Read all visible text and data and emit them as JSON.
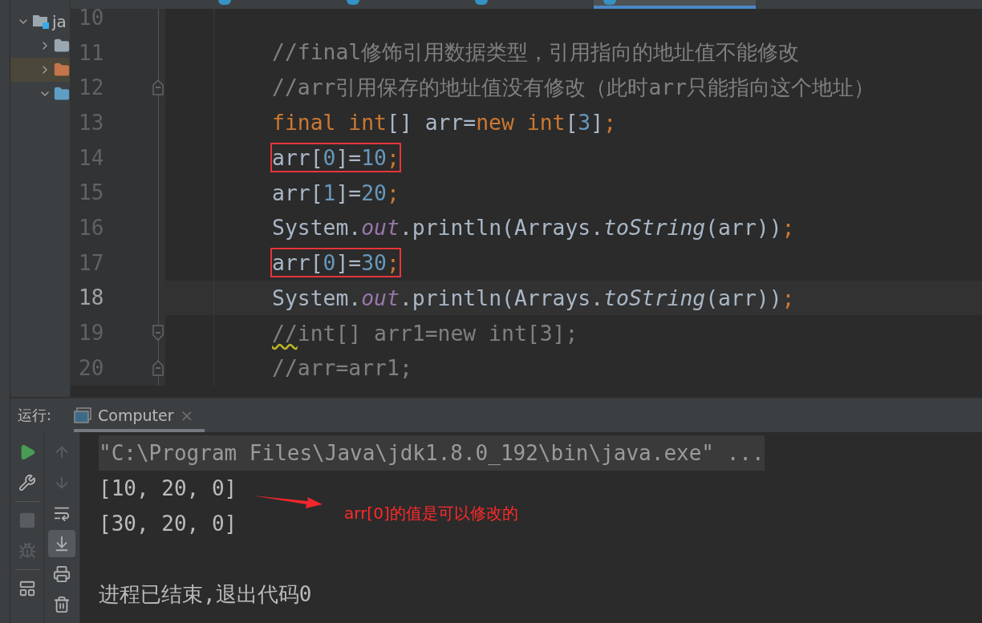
{
  "editor_tabs": [
    {
      "selected": false
    },
    {
      "selected": false
    },
    {
      "selected": false
    },
    {
      "selected": true
    }
  ],
  "project_tree": [
    {
      "label": "ja",
      "kind": "module",
      "expanded": true,
      "children": [
        {
          "kind": "folder-gray",
          "expanded": false
        },
        {
          "kind": "folder-orange",
          "expanded": false
        },
        {
          "kind": "folder-blue",
          "expanded": true
        }
      ]
    }
  ],
  "code_lines": [
    {
      "number": "10",
      "current": false
    },
    {
      "number": "11",
      "current": false,
      "boxed": false,
      "tokens": [
        {
          "kind": "comment",
          "text": "//final修饰引用数据类型，引用指向的地址值不能修改"
        }
      ]
    },
    {
      "number": "12",
      "current": false,
      "boxed": false,
      "fold": {
        "kind": "up"
      },
      "tokens": [
        {
          "kind": "comment",
          "text": "//arr引用保存的地址值没有修改（此时arr只能指向这个地址）"
        }
      ]
    },
    {
      "number": "13",
      "current": false,
      "boxed": false,
      "tokens": [
        {
          "kind": "keyword",
          "text": "final int"
        },
        {
          "kind": "plain",
          "text": "[] arr="
        },
        {
          "kind": "keyword",
          "text": "new int"
        },
        {
          "kind": "plain",
          "text": "["
        },
        {
          "kind": "number",
          "text": "3"
        },
        {
          "kind": "plain",
          "text": "]"
        },
        {
          "kind": "keyword",
          "text": ";"
        }
      ]
    },
    {
      "number": "14",
      "current": false,
      "boxed": true,
      "tokens": [
        {
          "kind": "plain",
          "text": "arr["
        },
        {
          "kind": "number",
          "text": "0"
        },
        {
          "kind": "plain",
          "text": "]="
        },
        {
          "kind": "number",
          "text": "10"
        },
        {
          "kind": "keyword",
          "text": ";"
        }
      ]
    },
    {
      "number": "15",
      "current": false,
      "boxed": false,
      "tokens": [
        {
          "kind": "plain",
          "text": "arr["
        },
        {
          "kind": "number",
          "text": "1"
        },
        {
          "kind": "plain",
          "text": "]="
        },
        {
          "kind": "number",
          "text": "20"
        },
        {
          "kind": "keyword",
          "text": ";"
        }
      ]
    },
    {
      "number": "16",
      "current": false,
      "boxed": false,
      "tokens": [
        {
          "kind": "plain",
          "text": "System."
        },
        {
          "kind": "field",
          "text": "out"
        },
        {
          "kind": "plain",
          "text": ".println(Arrays."
        },
        {
          "kind": "static",
          "text": "toString"
        },
        {
          "kind": "plain",
          "text": "(arr))"
        },
        {
          "kind": "keyword",
          "text": ";"
        }
      ]
    },
    {
      "number": "17",
      "current": false,
      "boxed": true,
      "tokens": [
        {
          "kind": "plain",
          "text": "arr["
        },
        {
          "kind": "number",
          "text": "0"
        },
        {
          "kind": "plain",
          "text": "]="
        },
        {
          "kind": "number",
          "text": "30"
        },
        {
          "kind": "keyword",
          "text": ";"
        }
      ]
    },
    {
      "number": "18",
      "current": true,
      "boxed": false,
      "tokens": [
        {
          "kind": "plain",
          "text": "System."
        },
        {
          "kind": "field",
          "text": "out"
        },
        {
          "kind": "plain",
          "text": ".println(Arrays."
        },
        {
          "kind": "static",
          "text": "toString"
        },
        {
          "kind": "plain",
          "text": "(arr))"
        },
        {
          "kind": "keyword",
          "text": ";"
        }
      ]
    },
    {
      "number": "19",
      "current": false,
      "boxed": false,
      "fold": {
        "kind": "down"
      },
      "tokens": [
        {
          "kind": "comment-warn",
          "text": "//"
        },
        {
          "kind": "comment",
          "text": "int[] arr1=new int[3];"
        }
      ]
    },
    {
      "number": "20",
      "current": false,
      "boxed": false,
      "fold": {
        "kind": "up"
      },
      "tokens": [
        {
          "kind": "comment",
          "text": "//arr=arr1;"
        }
      ]
    }
  ],
  "run_panel": {
    "label": "运行:",
    "tab": {
      "title": "Computer",
      "close": "×"
    },
    "toolbar_left": [
      {
        "kind": "run",
        "disabled": false
      },
      {
        "kind": "wrench",
        "disabled": false
      },
      {
        "kind": "separator"
      },
      {
        "kind": "stop",
        "disabled": true
      },
      {
        "kind": "debug",
        "disabled": true
      },
      {
        "kind": "separator"
      },
      {
        "kind": "layout",
        "disabled": false
      }
    ],
    "toolbar_right": [
      {
        "kind": "up",
        "disabled": true,
        "selected": false
      },
      {
        "kind": "down",
        "disabled": true,
        "selected": false
      },
      {
        "kind": "wrap",
        "disabled": false,
        "selected": false
      },
      {
        "kind": "scroll-end",
        "disabled": false,
        "selected": true
      },
      {
        "kind": "print",
        "disabled": false,
        "selected": false
      },
      {
        "kind": "trash",
        "disabled": false,
        "selected": false
      }
    ],
    "console": [
      {
        "kind": "command",
        "text": "\"C:\\Program Files\\Java\\jdk1.8.0_192\\bin\\java.exe\" ..."
      },
      {
        "kind": "output",
        "text": "[10, 20, 0]"
      },
      {
        "kind": "output",
        "text": "[30, 20, 0]"
      },
      {
        "kind": "exit",
        "text": "进程已结束,退出代码0"
      }
    ],
    "annotation": "arr[0]的值是可以修改的"
  }
}
